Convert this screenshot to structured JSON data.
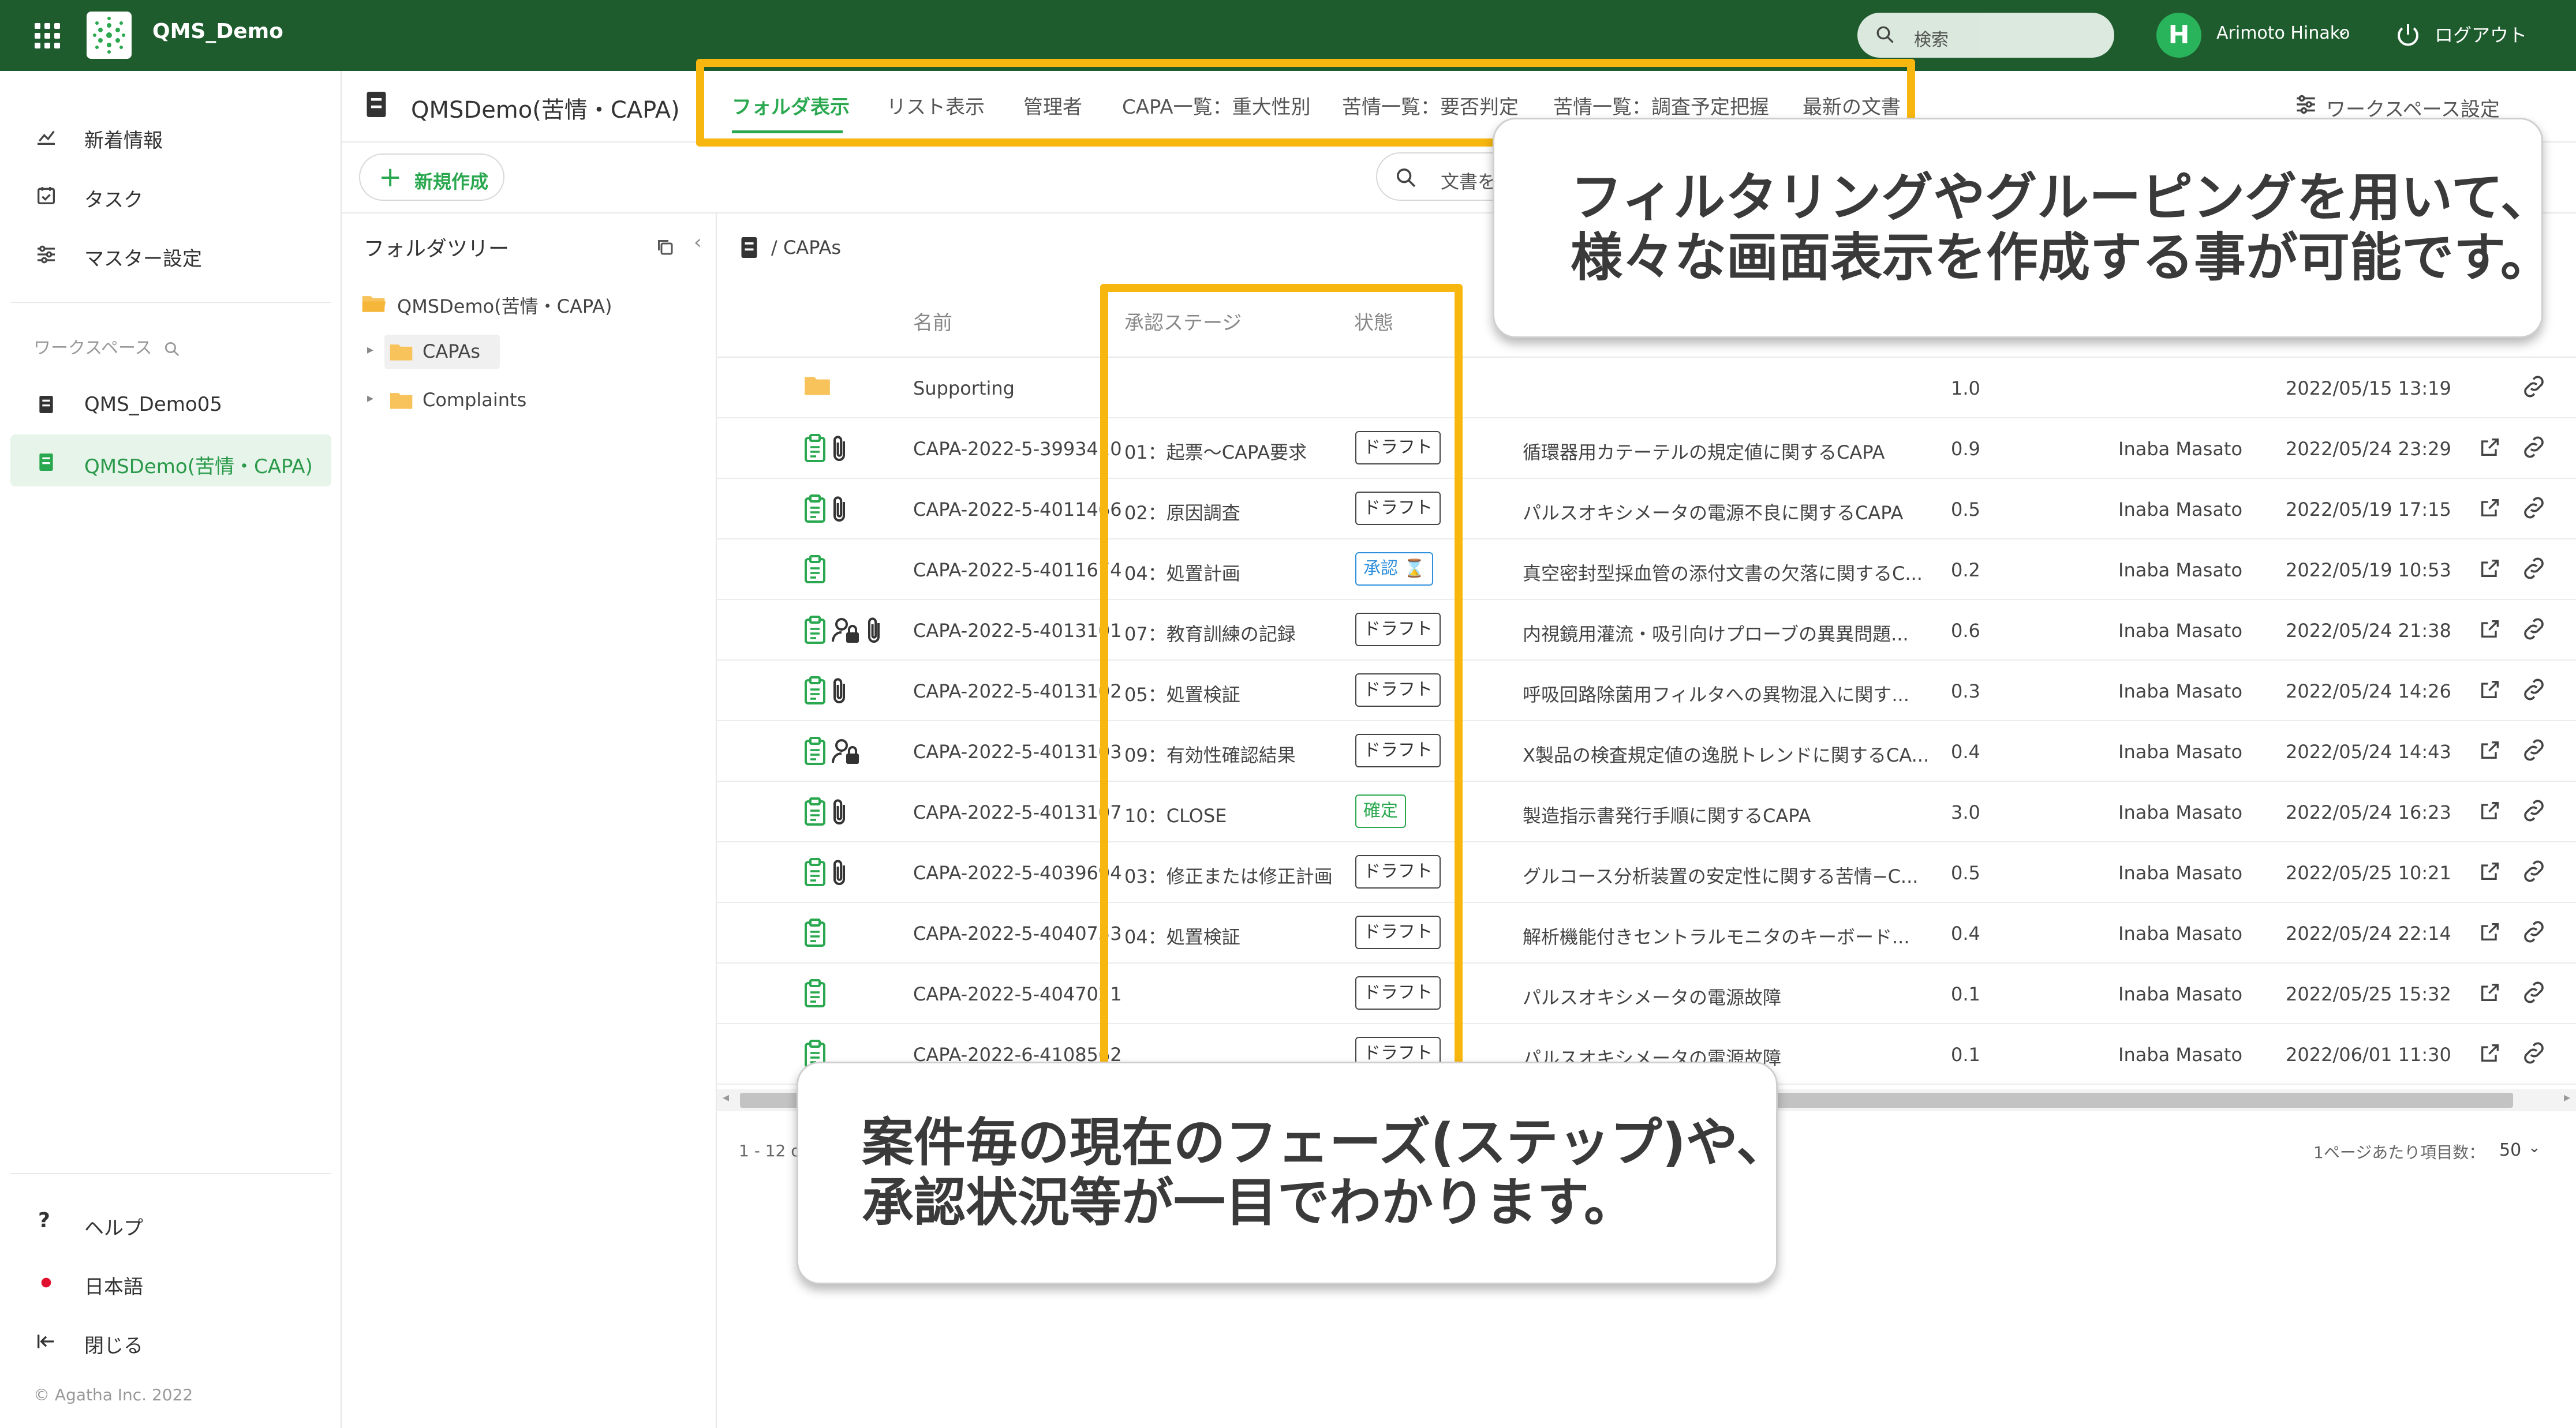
{
  "topbar": {
    "app_title": "QMS_Demo",
    "search_placeholder": "検索",
    "avatar_initial": "H",
    "user_name": "Arimoto Hinako",
    "logout_label": "ログアウト",
    "bg_color": "#1e5c2e"
  },
  "sidebar": {
    "top_items": [
      {
        "label": "新着情報",
        "icon": "chart-icon"
      },
      {
        "label": "タスク",
        "icon": "calendar-check-icon"
      },
      {
        "label": "マスター設定",
        "icon": "sliders-icon"
      }
    ],
    "workspace_header": "ワークスペース",
    "workspaces": [
      {
        "label": "QMS_Demo05",
        "icon": "workspace-icon"
      },
      {
        "label": "QMSDemo(苦情・CAPA)",
        "icon": "workspace-icon",
        "active": true
      }
    ],
    "bottom_items": [
      {
        "label": "ヘルプ",
        "icon": "help-icon"
      },
      {
        "label": "日本語",
        "icon": "japan-flag-icon"
      },
      {
        "label": "閉じる",
        "icon": "collapse-icon"
      }
    ],
    "copyright": "© Agatha Inc. 2022"
  },
  "header": {
    "workspace_title": "QMSDemo(苦情・CAPA)",
    "tabs": [
      "フォルダ表示",
      "リスト表示",
      "管理者",
      "CAPA一覧：重大性別",
      "苦情一覧：要否判定",
      "苦情一覧：調査予定把握",
      "最新の文書"
    ],
    "workspace_settings": "ワークスペース設定"
  },
  "toolbar": {
    "new_button": "新規作成",
    "doc_search_placeholder": "文書を"
  },
  "tree": {
    "title": "フォルダツリー",
    "root": "QMSDemo(苦情・CAPA)",
    "children": [
      "CAPAs",
      "Complaints"
    ]
  },
  "list": {
    "breadcrumb": "/  CAPAs",
    "columns": {
      "name": "名前",
      "stage": "承認ステージ",
      "status": "状態"
    },
    "rows": [
      {
        "name": "Supporting",
        "stage": "",
        "status": "",
        "title": "",
        "version": "1.0",
        "author": "",
        "date": "2022/05/15 13:19",
        "type": "folder"
      },
      {
        "name": "CAPA-2022-5-3993410",
        "stage": "01：起票〜CAPA要求",
        "status": "ドラフト",
        "title": "循環器用カテーテルの規定値に関するCAPA",
        "version": "0.9",
        "author": "Inaba Masato",
        "date": "2022/05/24 23:29",
        "type": "doc",
        "clip": true
      },
      {
        "name": "CAPA-2022-5-4011466",
        "stage": "02：原因調査",
        "status": "ドラフト",
        "title": "パルスオキシメータの電源不良に関するCAPA",
        "version": "0.5",
        "author": "Inaba Masato",
        "date": "2022/05/19 17:15",
        "type": "doc",
        "clip": true
      },
      {
        "name": "CAPA-2022-5-4011674",
        "stage": "04：処置計画",
        "status": "承認",
        "title": "真空密封型採血管の添付文書の欠落に関するC...",
        "version": "0.2",
        "author": "Inaba Masato",
        "date": "2022/05/19 10:53",
        "type": "doc"
      },
      {
        "name": "CAPA-2022-5-4013101",
        "stage": "07：教育訓練の記録",
        "status": "ドラフト",
        "title": "内視鏡用灌流・吸引向けプローブの異異問題...",
        "version": "0.6",
        "author": "Inaba Masato",
        "date": "2022/05/24 21:38",
        "type": "doc",
        "lock": true,
        "clip": true
      },
      {
        "name": "CAPA-2022-5-4013102",
        "stage": "05：処置検証",
        "status": "ドラフト",
        "title": "呼吸回路除菌用フィルタへの異物混入に関す...",
        "version": "0.3",
        "author": "Inaba Masato",
        "date": "2022/05/24 14:26",
        "type": "doc",
        "clip": true
      },
      {
        "name": "CAPA-2022-5-4013103",
        "stage": "09：有効性確認結果",
        "status": "ドラフト",
        "title": "X製品の検査規定値の逸脱トレンドに関するCA...",
        "version": "0.4",
        "author": "Inaba Masato",
        "date": "2022/05/24 14:43",
        "type": "doc",
        "lock": true
      },
      {
        "name": "CAPA-2022-5-4013107",
        "stage": "10：CLOSE",
        "status": "確定",
        "title": "製造指示書発行手順に関するCAPA",
        "version": "3.0",
        "author": "Inaba Masato",
        "date": "2022/05/24 16:23",
        "type": "doc",
        "clip": true
      },
      {
        "name": "CAPA-2022-5-4039694",
        "stage": "03：修正または修正計画",
        "status": "ドラフト",
        "title": "グルコース分析装置の安定性に関する苦情−C...",
        "version": "0.5",
        "author": "Inaba Masato",
        "date": "2022/05/25 10:21",
        "type": "doc",
        "clip": true
      },
      {
        "name": "CAPA-2022-5-4040753",
        "stage": "04：処置検証",
        "status": "ドラフト",
        "title": "解析機能付きセントラルモニタのキーボード...",
        "version": "0.4",
        "author": "Inaba Masato",
        "date": "2022/05/24 22:14",
        "type": "doc"
      },
      {
        "name": "CAPA-2022-5-4047021",
        "stage": "",
        "status": "ドラフト",
        "title": "パルスオキシメータの電源故障",
        "version": "0.1",
        "author": "Inaba Masato",
        "date": "2022/05/25 15:32",
        "type": "doc"
      },
      {
        "name": "CAPA-2022-6-4108562",
        "stage": "",
        "status": "ドラフト",
        "title": "パルスオキシメータの電源故障",
        "version": "0.1",
        "author": "Inaba Masato",
        "date": "2022/06/01 11:30",
        "type": "doc"
      }
    ],
    "pager_count": "1 - 12 of",
    "per_page_label": "1ページあたり項目数：",
    "per_page_value": "50"
  },
  "callouts": {
    "top_line1": "フィルタリングやグルーピングを用いて、",
    "top_line2": "様々な画面表示を作成する事が可能です。",
    "bottom_line1": "案件毎の現在のフェーズ(ステップ)や、",
    "bottom_line2": "承認状況等が一目でわかります。",
    "highlight_color": "#f8b70f"
  }
}
